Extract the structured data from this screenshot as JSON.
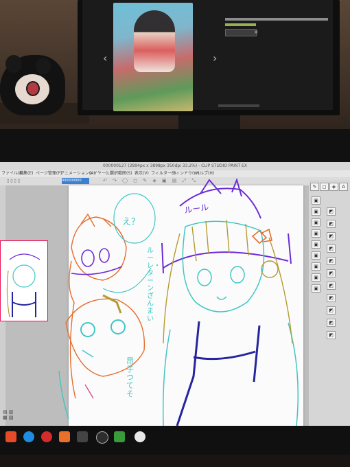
{
  "app": {
    "title": "000000127 (2894px x 3898px 350dpi 33.2%) - CLIP STUDIO PAINT EX",
    "tab": "000000000"
  },
  "menu": {
    "items": [
      "ファイル(F)",
      "編集(E)",
      "ページ管理(P)",
      "アニメーション(A)",
      "レイヤー(L)",
      "選択範囲(S)",
      "表示(V)",
      "フィルター(I)",
      "ウィンドウ(W)",
      "ヘルプ(H)"
    ]
  },
  "toolbar": {
    "icons": "↶ ↷ ◯ ◻ ✎ ◈ ▣ ▤ ⤢ ⤡"
  },
  "sketch": {
    "note_right": "ルール",
    "note_bubble": "え？",
    "note_vertical": "ルーレ・ターンざんまい",
    "note_lower": "昂子つてそ"
  },
  "monitor": {
    "prev_arrow": "‹",
    "next_arrow": "›",
    "close": "×"
  },
  "colors": {
    "violet": "#6b2bd6",
    "navy": "#25249e",
    "teal": "#3fc6c4",
    "orange": "#e56b2b",
    "olive": "#b59a31",
    "pink": "#d44f93"
  },
  "icons": [
    "panel-brush-icon",
    "panel-eraser-icon",
    "panel-fill-icon",
    "panel-text-icon"
  ]
}
